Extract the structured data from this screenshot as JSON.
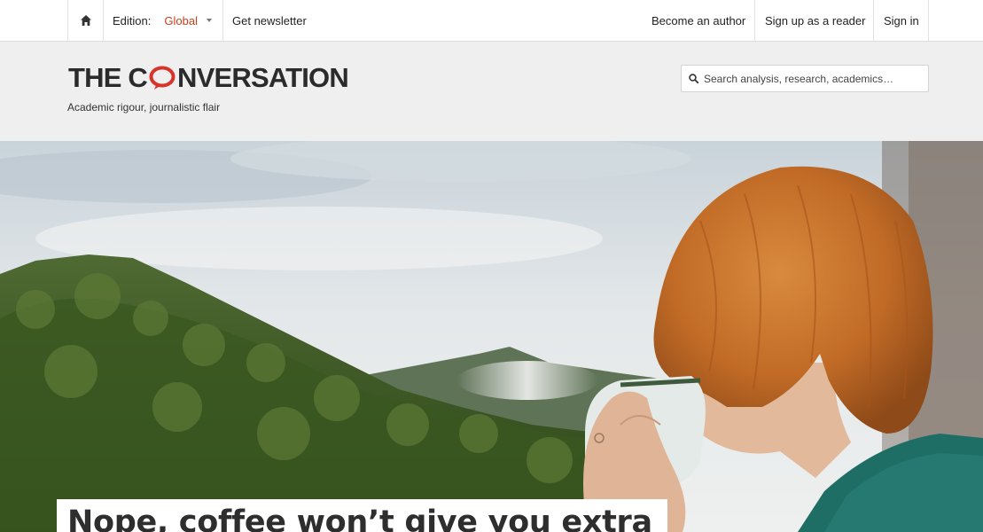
{
  "topnav": {
    "edition_label": "Edition:",
    "edition_value": "Global",
    "newsletter": "Get newsletter",
    "become_author": "Become an author",
    "sign_up_reader": "Sign up as a reader",
    "sign_in": "Sign in"
  },
  "header": {
    "logo_part1": "THE C",
    "logo_part2": "NVERSATION",
    "tagline": "Academic rigour, journalistic flair",
    "search_placeholder": "Search analysis, research, academics…"
  },
  "hero": {
    "headline": "Nope, coffee won’t give you extra"
  },
  "icons": {
    "home": "home-icon",
    "dropdown": "chevron-down-icon",
    "search": "search-icon",
    "logo_bubble": "speech-bubble-icon"
  },
  "colors": {
    "accent": "#c8401f",
    "masthead_bg": "#efefef",
    "logo_bubble": "#d8352a"
  }
}
